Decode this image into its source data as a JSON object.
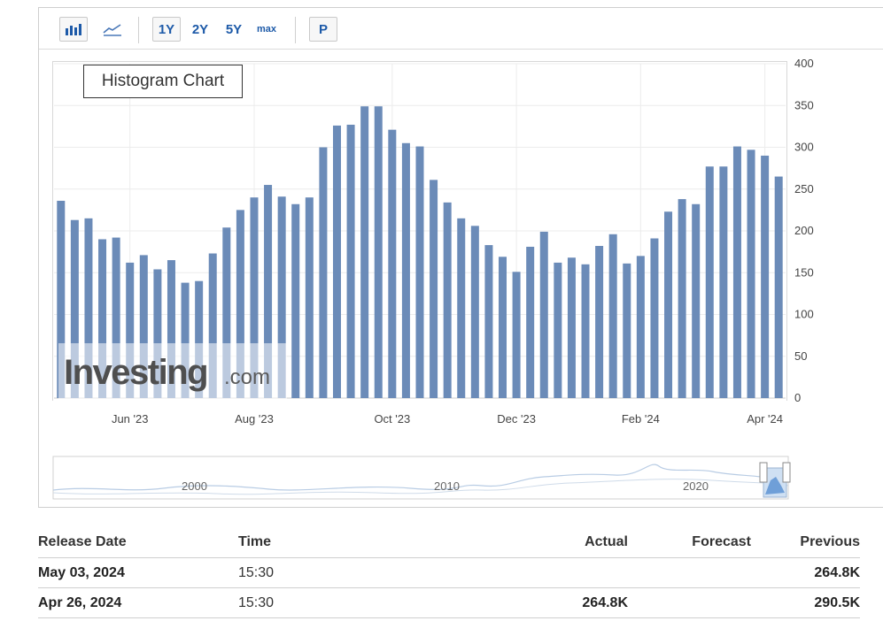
{
  "toolbar": {
    "bar_icon": "bar-chart-icon",
    "line_icon": "line-chart-icon",
    "ranges": [
      "1Y",
      "2Y",
      "5Y",
      "max"
    ],
    "p_label": "P"
  },
  "chart": {
    "histogram_label": "Histogram Chart",
    "watermark_main": "Investing",
    "watermark_suffix": ".com"
  },
  "navigator": {
    "labels": [
      "2000",
      "2010",
      "2020"
    ]
  },
  "colors": {
    "bar": "#6b8bb8",
    "accent": "#1d5aa8"
  },
  "table": {
    "headers": {
      "date": "Release Date",
      "time": "Time",
      "actual": "Actual",
      "forecast": "Forecast",
      "previous": "Previous"
    },
    "rows": [
      {
        "date": "May 03, 2024",
        "time": "15:30",
        "actual": "",
        "forecast": "",
        "previous": "264.8K"
      },
      {
        "date": "Apr 26, 2024",
        "time": "15:30",
        "actual": "264.8K",
        "forecast": "",
        "previous": "290.5K"
      }
    ]
  },
  "chart_data": {
    "type": "bar",
    "ylim": [
      0,
      400
    ],
    "yticks": [
      0,
      50,
      100,
      150,
      200,
      250,
      300,
      350,
      400
    ],
    "xtick_labels": [
      "Jun '23",
      "Aug '23",
      "Oct '23",
      "Dec '23",
      "Feb '24",
      "Apr '24"
    ],
    "xtick_indices": [
      5,
      14,
      24,
      33,
      42,
      51
    ],
    "grid": true,
    "values": [
      236,
      213,
      215,
      190,
      192,
      162,
      171,
      154,
      165,
      138,
      140,
      173,
      204,
      225,
      240,
      255,
      241,
      232,
      240,
      300,
      326,
      327,
      349,
      349,
      321,
      305,
      301,
      261,
      234,
      215,
      206,
      183,
      169,
      151,
      181,
      199,
      162,
      168,
      160,
      182,
      196,
      161,
      170,
      191,
      223,
      238,
      232,
      277,
      277,
      301,
      297,
      290,
      265
    ]
  }
}
